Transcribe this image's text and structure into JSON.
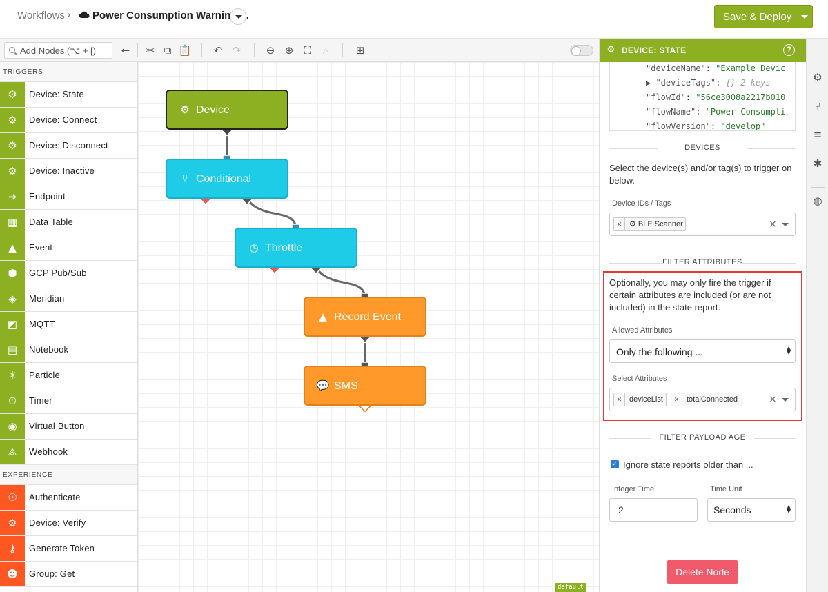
{
  "header": {
    "breadcrumb": "Workflows",
    "breadcrumb_sep": "›",
    "title": "Power Consumption Warning:...",
    "deploy_label": "Save & Deploy"
  },
  "toolbar": {
    "search_placeholder": "Add Nodes (⌥ + [)"
  },
  "palette": {
    "triggers_heading": "TRIGGERS",
    "triggers": [
      {
        "label": "Device: State",
        "icon": "chip-icon"
      },
      {
        "label": "Device: Connect",
        "icon": "chip-icon"
      },
      {
        "label": "Device: Disconnect",
        "icon": "chip-icon"
      },
      {
        "label": "Device: Inactive",
        "icon": "chip-icon"
      },
      {
        "label": "Endpoint",
        "icon": "endpoint-icon"
      },
      {
        "label": "Data Table",
        "icon": "table-icon"
      },
      {
        "label": "Event",
        "icon": "warning-icon"
      },
      {
        "label": "GCP Pub/Sub",
        "icon": "gcp-icon"
      },
      {
        "label": "Meridian",
        "icon": "meridian-icon"
      },
      {
        "label": "MQTT",
        "icon": "mqtt-icon"
      },
      {
        "label": "Notebook",
        "icon": "notebook-icon"
      },
      {
        "label": "Particle",
        "icon": "particle-icon"
      },
      {
        "label": "Timer",
        "icon": "timer-icon"
      },
      {
        "label": "Virtual Button",
        "icon": "button-icon"
      },
      {
        "label": "Webhook",
        "icon": "webhook-icon"
      }
    ],
    "experience_heading": "EXPERIENCE",
    "experience": [
      {
        "label": "Authenticate",
        "icon": "fingerprint-icon"
      },
      {
        "label": "Device: Verify",
        "icon": "chip-icon"
      },
      {
        "label": "Generate Token",
        "icon": "key-icon"
      },
      {
        "label": "Group: Get",
        "icon": "group-icon"
      }
    ]
  },
  "canvas": {
    "nodes": {
      "device": "Device",
      "conditional": "Conditional",
      "throttle": "Throttle",
      "record_event": "Record Event",
      "sms": "SMS"
    },
    "branch_tag": "default"
  },
  "panel": {
    "title": "DEVICE: STATE",
    "help": "?",
    "json_lines": [
      {
        "key": "\"deviceName\"",
        "val": "\"Example Devic"
      },
      {
        "key": "▶ \"deviceTags\"",
        "meta": "{} 2 keys"
      },
      {
        "key": "\"flowId\"",
        "val": "\"56ce3008a2217b010"
      },
      {
        "key": "\"flowName\"",
        "val": "\"Power Consumpti"
      },
      {
        "key": "\"flowVersion\"",
        "val": "\"develop\""
      }
    ],
    "devices_heading": "DEVICES",
    "devices_text": "Select the device(s) and/or tag(s) to trigger on below.",
    "device_ids_label": "Device IDs / Tags",
    "device_chip": "BLE Scanner",
    "filter_attr_heading": "FILTER ATTRIBUTES",
    "filter_attr_text": "Optionally, you may only fire the trigger if certain attributes are included (or are not included) in the state report.",
    "allowed_label": "Allowed Attributes",
    "allowed_value": "Only the following ...",
    "select_attr_label": "Select Attributes",
    "attr_chips": [
      "deviceList",
      "totalConnected"
    ],
    "payload_heading": "FILTER PAYLOAD AGE",
    "ignore_label": "Ignore state reports older than ...",
    "integer_label": "Integer Time",
    "integer_value": "2",
    "unit_label": "Time Unit",
    "unit_value": "Seconds",
    "delete_label": "Delete Node"
  }
}
